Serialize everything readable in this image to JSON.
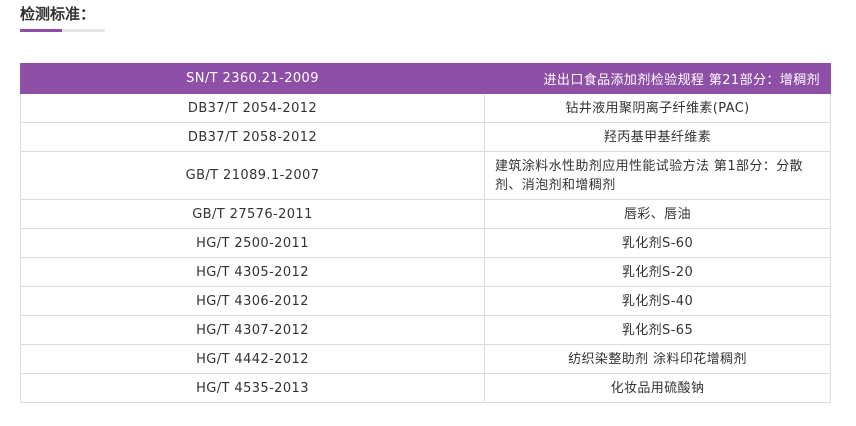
{
  "section": {
    "title": "检测标准：",
    "accent_color": "#8e4fa6"
  },
  "table": {
    "header": {
      "code": "SN/T 2360.21-2009",
      "name": "进出口食品添加剂检验规程 第21部分：增稠剂"
    },
    "rows": [
      {
        "code": "DB37/T 2054-2012",
        "name": "钻井液用聚阴离子纤维素(PAC)"
      },
      {
        "code": "DB37/T 2058-2012",
        "name": "羟丙基甲基纤维素"
      },
      {
        "code": "GB/T 21089.1-2007",
        "name": "建筑涂料水性助剂应用性能试验方法 第1部分：分散剂、消泡剂和增稠剂"
      },
      {
        "code": "GB/T 27576-2011",
        "name": "唇彩、唇油"
      },
      {
        "code": "HG/T 2500-2011",
        "name": "乳化剂S-60"
      },
      {
        "code": "HG/T 4305-2012",
        "name": "乳化剂S-20"
      },
      {
        "code": "HG/T 4306-2012",
        "name": "乳化剂S-40"
      },
      {
        "code": "HG/T 4307-2012",
        "name": "乳化剂S-65"
      },
      {
        "code": "HG/T 4442-2012",
        "name": "纺织染整助剂 涂料印花增稠剂"
      },
      {
        "code": "HG/T 4535-2013",
        "name": "化妆品用硫酸钠"
      }
    ]
  }
}
